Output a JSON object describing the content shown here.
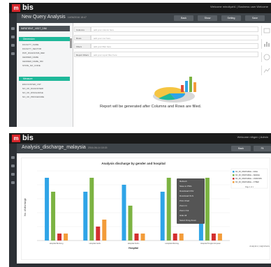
{
  "panel1": {
    "brand": {
      "badge": "m",
      "name": "bis"
    },
    "welcome": "Welcome minoliyah1 | Business user Welcome",
    "title": "New Query Analysis",
    "title_date": "14/06/2016 18:47",
    "buttons": [
      "Back",
      "Show",
      "Setting",
      "Save"
    ],
    "dropdown": "INPATIENT_VISIT_DIM",
    "dimension_header": "Dimension",
    "fields": [
      "FACILITY_NAME",
      "FACILITY_SECTOR",
      "PATI_DIAGNOSIS_REF",
      "GENDER_NAME",
      "GENDER_NAME_NM",
      "STATE_NO_CODE"
    ],
    "measure_header": "Measure",
    "measures": [
      "ENCOUNTER_CNT",
      "NO_OF_DIAGNOSED",
      "NO_OF_DISCHARGE",
      "NO_OF_PROCEDURE"
    ],
    "query_rows": [
      {
        "label": "Columns",
        "placeholder": "add your column here"
      },
      {
        "label": "Rows",
        "placeholder": "add your row here"
      },
      {
        "label": "Filters",
        "placeholder": "add your filter here"
      },
      {
        "label": "Report Filters",
        "placeholder": "add your report filter here"
      }
    ],
    "message": "Report will be generated after Columns and Rows are filled."
  },
  "panel2": {
    "brand": {
      "badge": "m",
      "name": "bis"
    },
    "welcome": "Welcome nthgen | Admin",
    "title": "Analysis_discharge_malaysia",
    "title_date": "2016-06-14 18:15",
    "buttons": [
      "Back",
      "Fil"
    ],
    "context_menu": [
      "Refresh",
      "Save to PNG",
      "Download CSV",
      "Download XLS",
      "Print Chart",
      "Zoom In",
      "Zoom Out",
      "Hide All",
      "Select Drag Zoom"
    ],
    "credit": "Analytics | Highcharts",
    "pager": "Page 1 of 1"
  },
  "chart_data": {
    "type": "bar",
    "title": "Analysis discharge by gender and hospital",
    "xlabel": "Hospital",
    "ylabel": "No. of discharge",
    "ylim": [
      0,
      10
    ],
    "categories": [
      "Hospital Bentong",
      "Hospital Gerik",
      "Hospital Kulim",
      "Hospital Mersing",
      "Hospital Tengku Ampuan"
    ],
    "series": [
      {
        "name": "NO_OF_DISCHARGE -- MALE",
        "color": "#2fa4e7",
        "values": [
          9,
          7,
          8,
          7,
          7
        ]
      },
      {
        "name": "NO_OF_DISCHARGE -- FEMALE",
        "color": "#7cb342",
        "values": [
          7,
          9,
          5,
          9,
          9
        ]
      },
      {
        "name": "NO_OF_DISCHARGE -- UNKNOWN",
        "color": "#d32f2f",
        "values": [
          1,
          2,
          1,
          1,
          1
        ]
      },
      {
        "name": "NO_OF_DISCHARGE -- OTHER",
        "color": "#f39c3a",
        "values": [
          1,
          3,
          1,
          1,
          1
        ]
      }
    ],
    "legend_position": "top-right"
  }
}
